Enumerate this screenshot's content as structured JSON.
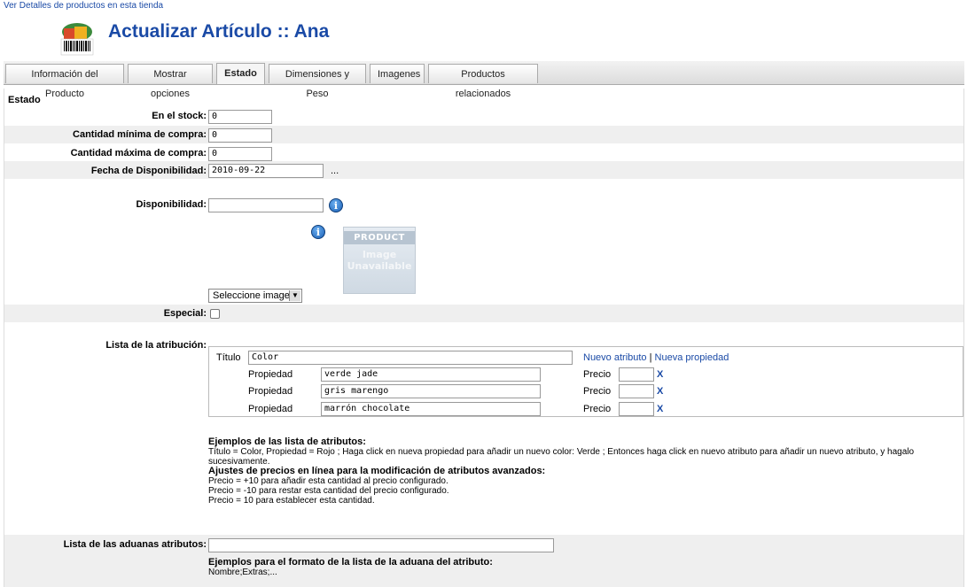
{
  "top_link": "Ver Detalles de productos en esta tienda",
  "page_title": "Actualizar Artículo :: Ana",
  "tabs": [
    {
      "label": "Información del Producto"
    },
    {
      "label": "Mostrar opciones"
    },
    {
      "label": "Estado"
    },
    {
      "label": "Dimensiones y Peso"
    },
    {
      "label": "Imagenes"
    },
    {
      "label": "Productos relacionados"
    }
  ],
  "active_tab": "Estado",
  "section_title": "Estado",
  "fields": {
    "stock": {
      "label": "En el stock:",
      "value": "0"
    },
    "min_qty": {
      "label": "Cantidad mínima de compra:",
      "value": "0"
    },
    "max_qty": {
      "label": "Cantidad máxima de compra:",
      "value": "0"
    },
    "date": {
      "label": "Fecha de Disponibilidad:",
      "value": "2010-09-22",
      "picker": "..."
    },
    "availability": {
      "label": "Disponibilidad:",
      "value": ""
    },
    "image_select": "Seleccione imagen",
    "special": {
      "label": "Especial:"
    },
    "attr_list": {
      "label": "Lista de la atribución:"
    },
    "customs_list": {
      "label": "Lista de las aduanas atributos:",
      "value": ""
    }
  },
  "product_image": {
    "line1": "PRODUCT",
    "line2": "Image",
    "line3": "Unavailable"
  },
  "info_icon_glyph": "i",
  "attributes": {
    "title_label": "Título",
    "title_value": "Color",
    "new_attr_link": "Nuevo atributo",
    "separator": "|",
    "new_prop_link": "Nueva propiedad",
    "prop_label": "Propiedad",
    "price_label": "Precio",
    "remove_label": "X",
    "properties": [
      {
        "value": "verde jade",
        "price": ""
      },
      {
        "value": "gris marengo",
        "price": ""
      },
      {
        "value": "marrón chocolate",
        "price": ""
      }
    ]
  },
  "help": {
    "h1": "Ejemplos de las lista de atributos:",
    "p1": "Título = Color, Propiedad = Rojo ; Haga click en nueva propiedad para añadir un nuevo color: Verde ; Entonces haga click en nuevo atributo para añadir un nuevo atributo, y hagalo sucesivamente.",
    "h2": "Ajustes de precios en línea para la modificación de atributos avanzados:",
    "p2": "Precio = +10 para añadir esta cantidad al precio configurado.",
    "p3": "Precio = -10 para restar esta cantidad del precio configurado.",
    "p4": "Precio = 10 para establecer esta cantidad.",
    "h3": "Ejemplos para el formato de la lista de la aduana del atributo:",
    "p5": "Nombre;Extras;..."
  }
}
